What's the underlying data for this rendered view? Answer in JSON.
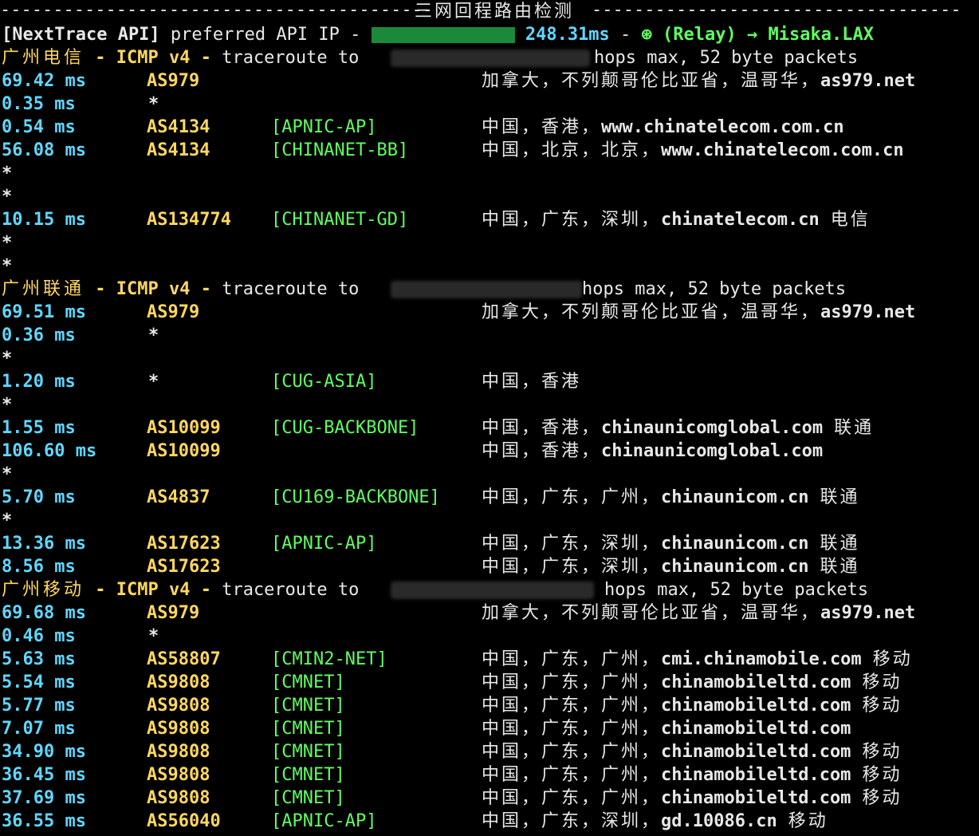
{
  "header": {
    "title": "三网回程路由检测",
    "api_prefix": "[NextTrace API]",
    "api_text": " preferred API IP - ",
    "api_latency": " 248.31ms",
    "api_sep": " - ",
    "relay_icon": "⊛",
    "relay": " (Relay) → Misaka.LAX"
  },
  "sections": [
    {
      "isp": "广州电信",
      "proto": " - ICMP v4 - ",
      "traceroute": "traceroute to",
      "hops_text": "hops max, 52 byte packets",
      "rows": [
        {
          "ms": "69.42 ms",
          "as": "AS979",
          "net": "",
          "geo": "加拿大，不列颠哥伦比亚省，温哥华，",
          "host": "as979.net",
          "isp": ""
        },
        {
          "ms": "0.35 ms",
          "as": "*",
          "net": "",
          "geo": "",
          "host": "",
          "isp": ""
        },
        {
          "ms": "0.54 ms",
          "as": "AS4134",
          "net": "[APNIC-AP]",
          "geo": "中国，香港，",
          "host": "www.chinatelecom.com.cn",
          "isp": ""
        },
        {
          "ms": "56.08 ms",
          "as": "AS4134",
          "net": "[CHINANET-BB]",
          "geo": "中国，北京，北京，",
          "host": "www.chinatelecom.com.cn",
          "isp": ""
        },
        {
          "star": "*"
        },
        {
          "star": "*"
        },
        {
          "ms": "10.15 ms",
          "as": "AS134774",
          "net": "[CHINANET-GD]",
          "geo": "中国，广东，深圳，",
          "host": "chinatelecom.cn",
          "isp": "电信"
        },
        {
          "star": "*"
        },
        {
          "star": "*"
        }
      ]
    },
    {
      "isp": "广州联通",
      "proto": " - ICMP v4 - ",
      "traceroute": "traceroute to",
      "hops_text": "hops max, 52 byte packets",
      "rows": [
        {
          "ms": "69.51 ms",
          "as": "AS979",
          "net": "",
          "geo": "加拿大，不列颠哥伦比亚省，温哥华，",
          "host": "as979.net",
          "isp": ""
        },
        {
          "ms": "0.36 ms",
          "as": "*",
          "net": "",
          "geo": "",
          "host": "",
          "isp": ""
        },
        {
          "star": "*"
        },
        {
          "ms": "1.20 ms",
          "as": "*",
          "net": "[CUG-ASIA]",
          "geo": "中国，香港",
          "host": "",
          "isp": ""
        },
        {
          "star": "*"
        },
        {
          "ms": "1.55 ms",
          "as": "AS10099",
          "net": "[CUG-BACKBONE]",
          "geo": "中国，香港，",
          "host": "chinaunicomglobal.com",
          "isp": "联通"
        },
        {
          "ms": "106.60 ms",
          "as": "AS10099",
          "net": "",
          "geo": "中国，香港，",
          "host": "chinaunicomglobal.com",
          "isp": ""
        },
        {
          "star": "*"
        },
        {
          "ms": "5.70 ms",
          "as": "AS4837",
          "net": "[CU169-BACKBONE]",
          "geo": "中国，广东，广州，",
          "host": "chinaunicom.cn",
          "isp": "联通"
        },
        {
          "star": "*"
        },
        {
          "ms": "13.36 ms",
          "as": "AS17623",
          "net": "[APNIC-AP]",
          "geo": "中国，广东，深圳，",
          "host": "chinaunicom.cn",
          "isp": "联通"
        },
        {
          "ms": "8.56 ms",
          "as": "AS17623",
          "net": "",
          "geo": "中国，广东，深圳，",
          "host": "chinaunicom.cn",
          "isp": "联通"
        }
      ]
    },
    {
      "isp": "广州移动",
      "proto": " - ICMP v4 - ",
      "traceroute": "traceroute to",
      "hops_text": "hops max, 52 byte packets",
      "rows": [
        {
          "ms": "69.68 ms",
          "as": "AS979",
          "net": "",
          "geo": "加拿大，不列颠哥伦比亚省，温哥华，",
          "host": "as979.net",
          "isp": ""
        },
        {
          "ms": "0.46 ms",
          "as": "*",
          "net": "",
          "geo": "",
          "host": "",
          "isp": ""
        },
        {
          "ms": "5.63 ms",
          "as": "AS58807",
          "net": "[CMIN2-NET]",
          "geo": "中国，广东，广州，",
          "host": "cmi.chinamobile.com",
          "isp": "移动"
        },
        {
          "ms": "5.54 ms",
          "as": "AS9808",
          "net": "[CMNET]",
          "geo": "中国，广东，广州，",
          "host": "chinamobileltd.com",
          "isp": "移动"
        },
        {
          "ms": "5.77 ms",
          "as": "AS9808",
          "net": "[CMNET]",
          "geo": "中国，广东，广州，",
          "host": "chinamobileltd.com",
          "isp": "移动"
        },
        {
          "ms": "7.07 ms",
          "as": "AS9808",
          "net": "[CMNET]",
          "geo": "中国，广东，广州，",
          "host": "chinamobileltd.com",
          "isp": ""
        },
        {
          "ms": "34.90 ms",
          "as": "AS9808",
          "net": "[CMNET]",
          "geo": "中国，广东，广州，",
          "host": "chinamobileltd.com",
          "isp": "移动"
        },
        {
          "ms": "36.45 ms",
          "as": "AS9808",
          "net": "[CMNET]",
          "geo": "中国，广东，广州，",
          "host": "chinamobileltd.com",
          "isp": "移动"
        },
        {
          "ms": "37.69 ms",
          "as": "AS9808",
          "net": "[CMNET]",
          "geo": "中国，广东，广州，",
          "host": "chinamobileltd.com",
          "isp": "移动"
        },
        {
          "ms": "36.55 ms",
          "as": "AS56040",
          "net": "[APNIC-AP]",
          "geo": "中国，广东，深圳，",
          "host": "gd.10086.cn",
          "isp": "移动"
        }
      ]
    }
  ]
}
